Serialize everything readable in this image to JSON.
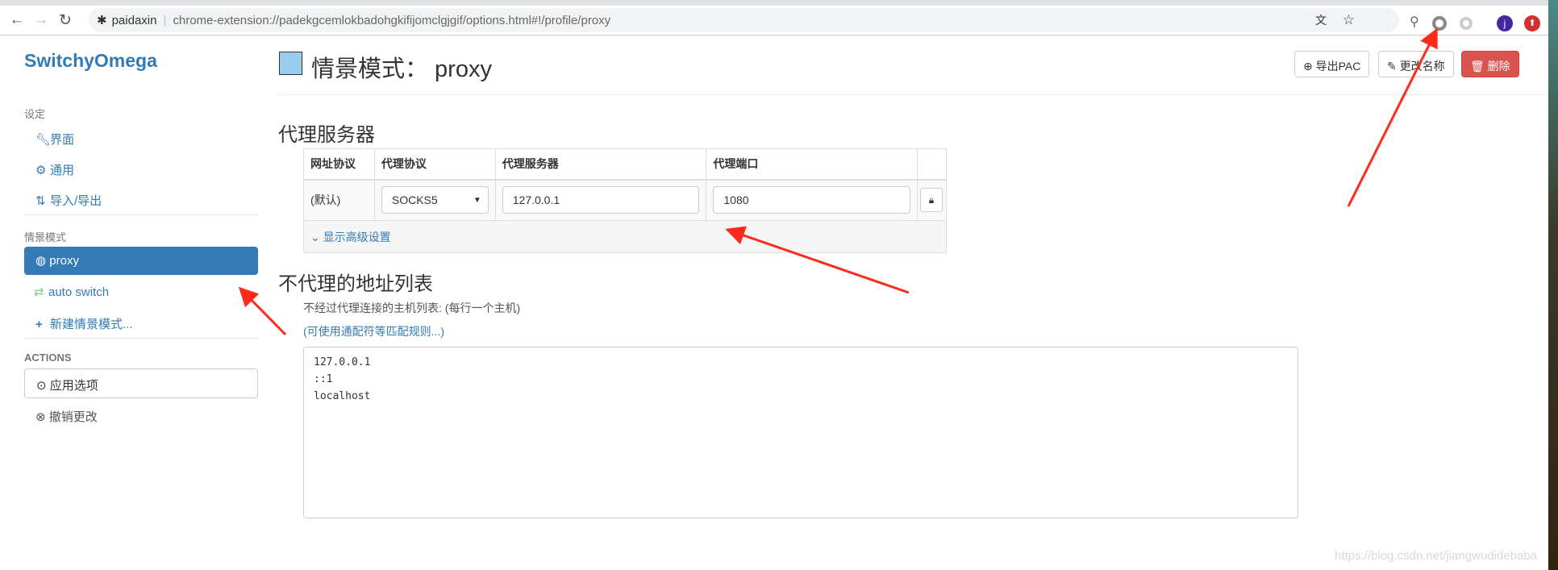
{
  "browser": {
    "site_name": "paidaxin",
    "url": "chrome-extension://padekgcemlokbadohgkifijomclgjgif/options.html#!/profile/proxy",
    "avatar_letter": "j"
  },
  "sidebar": {
    "brand": "SwitchyOmega",
    "settings_header": "设定",
    "settings_items": [
      {
        "label": "界面",
        "icon": "wrench-icon"
      },
      {
        "label": "通用",
        "icon": "gear-icon"
      },
      {
        "label": "导入/导出",
        "icon": "import-export-icon"
      }
    ],
    "profiles_header": "情景模式",
    "profiles": [
      {
        "label": "proxy",
        "icon": "globe-icon",
        "active": true
      },
      {
        "label": "auto switch",
        "icon": "retweet-icon"
      }
    ],
    "new_profile": "新建情景模式...",
    "actions_header": "ACTIONS",
    "apply": "应用选项",
    "discard": "撤销更改"
  },
  "header": {
    "title": "情景模式： proxy",
    "color": "#99ccee",
    "export_pac": "导出PAC",
    "rename": "更改名称",
    "delete": "删除"
  },
  "proxy_servers": {
    "heading": "代理服务器",
    "columns": [
      "网址协议",
      "代理协议",
      "代理服务器",
      "代理端口"
    ],
    "row": {
      "scheme": "(默认)",
      "protocol": "SOCKS5",
      "server": "127.0.0.1",
      "port": "1080"
    },
    "advanced": "显示高级设置"
  },
  "bypass": {
    "heading": "不代理的地址列表",
    "description": "不经过代理连接的主机列表: (每行一个主机)",
    "wildcard_link": "(可使用通配符等匹配规则...)",
    "list": "127.0.0.1\n::1\nlocalhost"
  },
  "watermark": "https://blog.csdn.net/jiangwudidebaba",
  "colors": {
    "accent": "#337ab7",
    "danger": "#d9534f",
    "annotation": "#ff2a1a"
  }
}
